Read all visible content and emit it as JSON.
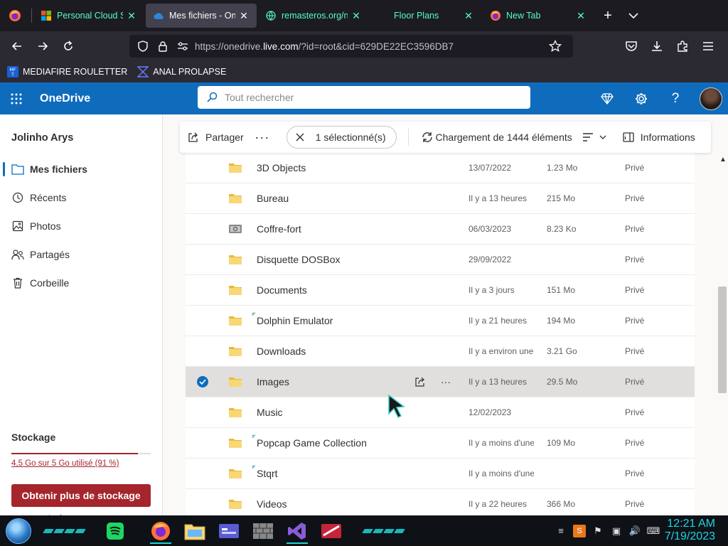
{
  "browser": {
    "tabs": [
      {
        "title": "Personal Cloud St",
        "icon": "windows-logo-icon",
        "active": false,
        "teal": true
      },
      {
        "title": "Mes fichiers - One",
        "icon": "onedrive-cloud-icon",
        "active": true,
        "teal": false
      },
      {
        "title": "remasteros.org/n",
        "icon": "globe-icon",
        "active": false,
        "teal": true
      },
      {
        "title": "Floor Plans",
        "icon": "none",
        "active": false,
        "teal": true
      },
      {
        "title": "New Tab",
        "icon": "firefox-icon",
        "active": false,
        "teal": true
      }
    ],
    "url_prefix": "https://onedrive.",
    "url_host": "live.com",
    "url_suffix": "/?id=root&cid=629DE22EC3596DB7",
    "bookmarks": [
      {
        "label": "MEDIAFIRE ROULETTER",
        "icon": "mediafire-icon"
      },
      {
        "label": "ANAL PROLAPSE",
        "icon": "bookmark-chevron-icon"
      }
    ]
  },
  "onedrive": {
    "brand": "OneDrive",
    "search_placeholder": "Tout rechercher",
    "user_name": "Jolinho Arys",
    "nav": [
      {
        "label": "Mes fichiers",
        "icon": "folder-icon",
        "active": true
      },
      {
        "label": "Récents",
        "icon": "clock-icon",
        "active": false
      },
      {
        "label": "Photos",
        "icon": "image-icon",
        "active": false
      },
      {
        "label": "Partagés",
        "icon": "people-icon",
        "active": false
      },
      {
        "label": "Corbeille",
        "icon": "trash-icon",
        "active": false
      }
    ],
    "storage": {
      "title": "Stockage",
      "usage_text": "4,5 Go sur 5 Go utilisé (91 %)",
      "used_fraction": 0.91,
      "button": "Obtenir plus de stockage",
      "link": "stockage"
    },
    "commands": {
      "share": "Partager",
      "more": "···",
      "selected": "1 sélectionné(s)",
      "loading": "Chargement de 1444 éléments",
      "info": "Informations"
    },
    "files": [
      {
        "name": "3D Objects",
        "date": "13/07/2022",
        "size": "1.23 Mo",
        "sharing": "Privé",
        "type": "folder",
        "sync": false,
        "selected": false
      },
      {
        "name": "Bureau",
        "date": "Il y a 13 heures",
        "size": "215 Mo",
        "sharing": "Privé",
        "type": "folder",
        "sync": false,
        "selected": false
      },
      {
        "name": "Coffre-fort",
        "date": "06/03/2023",
        "size": "8.23 Ko",
        "sharing": "Privé",
        "type": "vault",
        "sync": false,
        "selected": false
      },
      {
        "name": "Disquette DOSBox",
        "date": "29/09/2022",
        "size": "",
        "sharing": "Privé",
        "type": "folder",
        "sync": false,
        "selected": false
      },
      {
        "name": "Documents",
        "date": "Il y a 3 jours",
        "size": "151 Mo",
        "sharing": "Privé",
        "type": "folder",
        "sync": false,
        "selected": false
      },
      {
        "name": "Dolphin Emulator",
        "date": "Il y a 21 heures",
        "size": "194 Mo",
        "sharing": "Privé",
        "type": "folder",
        "sync": true,
        "selected": false
      },
      {
        "name": "Downloads",
        "date": "Il y a environ une",
        "size": "3.21 Go",
        "sharing": "Privé",
        "type": "folder",
        "sync": false,
        "selected": false
      },
      {
        "name": "Images",
        "date": "Il y a 13 heures",
        "size": "29.5 Mo",
        "sharing": "Privé",
        "type": "folder",
        "sync": false,
        "selected": true
      },
      {
        "name": "Music",
        "date": "12/02/2023",
        "size": "",
        "sharing": "Privé",
        "type": "folder",
        "sync": false,
        "selected": false
      },
      {
        "name": "Popcap Game Collection",
        "date": "Il y a moins d'une",
        "size": "109 Mo",
        "sharing": "Privé",
        "type": "folder",
        "sync": true,
        "selected": false
      },
      {
        "name": "Stqrt",
        "date": "Il y a moins d'une",
        "size": "",
        "sharing": "Privé",
        "type": "folder",
        "sync": true,
        "selected": false
      },
      {
        "name": "Videos",
        "date": "Il y a 22 heures",
        "size": "366 Mo",
        "sharing": "Privé",
        "type": "folder",
        "sync": false,
        "selected": false
      }
    ]
  },
  "taskbar": {
    "time": "12:21 AM",
    "date": "7/19/2023"
  },
  "colors": {
    "onedrive_blue": "#0f6cbd",
    "storage_red": "#a4262c",
    "folder_yellow": "#f8d775",
    "clock_teal": "#1bd6e6"
  }
}
